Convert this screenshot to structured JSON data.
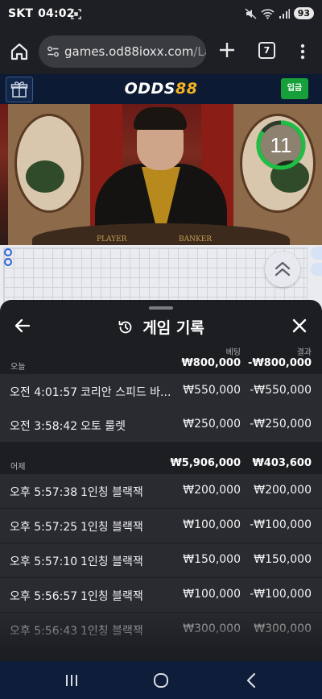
{
  "status_bar": {
    "carrier": "SKT",
    "time": "04:02",
    "battery": "93"
  },
  "browser": {
    "url_main": "games.od88ioxx.com",
    "url_rest": "/Laun",
    "tab_count": "7"
  },
  "site": {
    "logo_main": "ODDS",
    "logo_accent": "88",
    "deposit_label": "입금"
  },
  "video": {
    "countdown": "11",
    "countdown_fraction": 0.85,
    "table_left": "PLAYER",
    "table_right": "BANKER"
  },
  "sheet": {
    "title": "게임 기록",
    "col_bet": "베팅",
    "col_result": "결과",
    "groups": [
      {
        "day": "오늘",
        "total_bet": "₩800,000",
        "total_result": "-₩800,000",
        "rows": [
          {
            "time": "오전 4:01:57",
            "game": "코리안 스피드 바...",
            "bet": "₩550,000",
            "result": "-₩550,000"
          },
          {
            "time": "오전 3:58:42",
            "game": "오토 룰렛",
            "bet": "₩250,000",
            "result": "-₩250,000"
          }
        ]
      },
      {
        "day": "어제",
        "total_bet": "₩5,906,000",
        "total_result": "₩403,600",
        "rows": [
          {
            "time": "오후 5:57:38",
            "game": "1인칭 블랙잭",
            "bet": "₩200,000",
            "result": "₩200,000"
          },
          {
            "time": "오후 5:57:25",
            "game": "1인칭 블랙잭",
            "bet": "₩100,000",
            "result": "-₩100,000"
          },
          {
            "time": "오후 5:57:10",
            "game": "1인칭 블랙잭",
            "bet": "₩150,000",
            "result": "₩150,000"
          },
          {
            "time": "오후 5:56:57",
            "game": "1인칭 블랙잭",
            "bet": "₩100,000",
            "result": "-₩100,000"
          },
          {
            "time": "오후 5:56:43",
            "game": "1인칭 블랙잭",
            "bet": "₩300,000",
            "result": "₩300,000"
          }
        ]
      }
    ]
  },
  "colors": {
    "deposit": "#179f3a",
    "logo_accent": "#f2b320",
    "timer_ring": "#1fbf45",
    "road_blue": "#2b63d8"
  }
}
